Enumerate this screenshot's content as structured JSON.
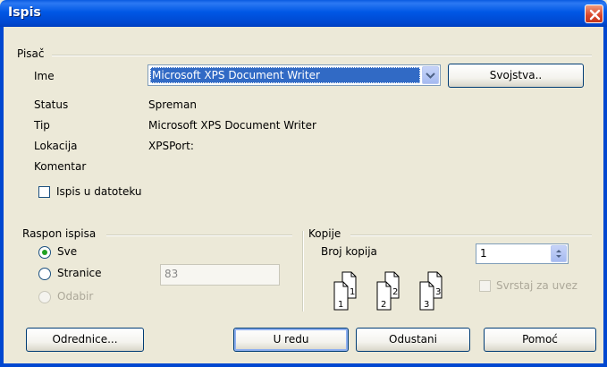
{
  "window": {
    "title": "Ispis"
  },
  "printer": {
    "group_label": "Pisač",
    "name_label": "Ime",
    "selected_printer": "Microsoft XPS Document Writer",
    "properties_button": "Svojstva..",
    "status_label": "Status",
    "status_value": "Spreman",
    "type_label": "Tip",
    "type_value": "Microsoft XPS Document Writer",
    "location_label": "Lokacija",
    "location_value": "XPSPort:",
    "comment_label": "Komentar",
    "print_to_file_label": "Ispis u datoteku",
    "print_to_file_checked": false
  },
  "range": {
    "group_label": "Raspon ispisa",
    "all_label": "Sve",
    "pages_label": "Stranice",
    "pages_value": "83",
    "selection_label": "Odabir",
    "selected_option": "all"
  },
  "copies": {
    "group_label": "Kopije",
    "count_label": "Broj kopija",
    "count_value": "1",
    "collate_label": "Svrstaj za uvez",
    "collate_checked": false,
    "page_icon_labels": [
      "1",
      "1",
      "2",
      "2",
      "3",
      "3"
    ]
  },
  "buttons": {
    "options": "Odrednice...",
    "ok": "U redu",
    "cancel": "Odustani",
    "help": "Pomoć"
  },
  "colors": {
    "titlebar": "#0055E5",
    "dialog_bg": "#ECE9D8",
    "selection": "#316AC5",
    "close_button": "#D8452A"
  }
}
